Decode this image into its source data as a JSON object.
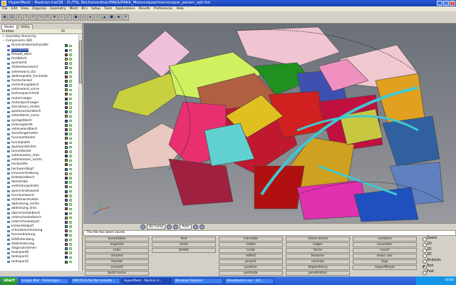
{
  "window": {
    "title": "HyperMesh - Nastran.hwl1B - D:/TSL Rechenordner/PAKA/PAKA_Monocoque/monocoque_param_opt.hm"
  },
  "menu": [
    "File",
    "Edit",
    "View",
    "Organize",
    "Geometry",
    "Mesh",
    "BCs",
    "Setup",
    "Tools",
    "Applications",
    "Results",
    "Preferences",
    "Help"
  ],
  "toolbar_icons": [
    "open-icon",
    "save-icon",
    "import-icon",
    "export-icon",
    "undo-icon",
    "redo-icon",
    "rotate-icon",
    "pan-icon",
    "zoom-icon",
    "fit-icon",
    "shade-icon",
    "wire-icon",
    "view-icon",
    "iso-icon",
    "top-icon",
    "front-icon",
    "side-icon",
    "light-icon"
  ],
  "panel": {
    "tabs": [
      "Model",
      "Utility"
    ],
    "header": {
      "entities": "Entities",
      "id": "ID"
    },
    "tree_top": [
      {
        "label": "Assembly Hierarchy"
      },
      {
        "label": "Components (80)"
      }
    ],
    "components": [
      {
        "name": "torsionsheberoehrplatte",
        "color": "#38a838"
      },
      {
        "name": "sitzrahmen",
        "color": "#2040d0"
      },
      {
        "name": "firewall_oben",
        "color": "#c03020"
      },
      {
        "name": "frontblech",
        "color": "#d8c020"
      },
      {
        "name": "querwand",
        "color": "#e070c0"
      },
      {
        "name": "sitzbankauswand",
        "color": "#a8a8a8"
      },
      {
        "name": "seitenwand_sitz",
        "color": "#30b0b0"
      },
      {
        "name": "abdeckplatte_frontseite",
        "color": "#e02020"
      },
      {
        "name": "frontschenkel",
        "color": "#808030"
      },
      {
        "name": "verbindungsblech",
        "color": "#3060a0"
      },
      {
        "name": "seitenwand_vorne",
        "color": "#90d030"
      },
      {
        "name": "kastenquerschnitt",
        "color": "#d06020"
      },
      {
        "name": "motortraeger",
        "color": "#7030a0"
      },
      {
        "name": "motorquertraeger",
        "color": "#40a060"
      },
      {
        "name": "sitzrahmen_hinten",
        "color": "#b02060"
      },
      {
        "name": "querbrueckenblech",
        "color": "#20a0d0"
      },
      {
        "name": "seitenblech_vorne",
        "color": "#e0a030"
      },
      {
        "name": "spriegelblech",
        "color": "#6040c0"
      },
      {
        "name": "lenkungsbrett",
        "color": "#50b050"
      },
      {
        "name": "seitenwandblech",
        "color": "#d03050"
      },
      {
        "name": "stossfangerhalter",
        "color": "#3080c0"
      },
      {
        "name": "fussraumboden",
        "color": "#a0a020"
      },
      {
        "name": "tunnelplatte",
        "color": "#c040a0"
      },
      {
        "name": "querwandhinten",
        "color": "#40c0a0"
      },
      {
        "name": "tunneldeckel",
        "color": "#e06040"
      },
      {
        "name": "seitenkasten_links",
        "color": "#2050b0"
      },
      {
        "name": "seitenkasten_rechts",
        "color": "#80b040"
      },
      {
        "name": "heckplatte",
        "color": "#b03030"
      },
      {
        "name": "heckwandkopf",
        "color": "#3070d0"
      },
      {
        "name": "kreuzverstrebung",
        "color": "#d0b040"
      },
      {
        "name": "federbeinblech",
        "color": "#5030a0"
      },
      {
        "name": "domstrebe",
        "color": "#30a070"
      },
      {
        "name": "verbindungsleiste",
        "color": "#c05080"
      },
      {
        "name": "querschnittswand",
        "color": "#2090c0"
      },
      {
        "name": "fussraumwand",
        "color": "#a06030"
      },
      {
        "name": "sitzlehnenstuetze",
        "color": "#6050d0"
      },
      {
        "name": "abdeckung_rechts",
        "color": "#40b040"
      },
      {
        "name": "abdeckung_links",
        "color": "#d04040"
      },
      {
        "name": "oberschenkelblech",
        "color": "#3050c0"
      },
      {
        "name": "unterschenkelblech",
        "color": "#b0a030"
      },
      {
        "name": "unterschenkelpart",
        "color": "#9040b0"
      },
      {
        "name": "kniewinkelpart",
        "color": "#30b090"
      },
      {
        "name": "schenkelverbindung",
        "color": "#e04060"
      },
      {
        "name": "fussverbindung",
        "color": "#2060b0"
      },
      {
        "name": "SUVAnbindung",
        "color": "#80c050"
      },
      {
        "name": "stabilisatorung",
        "color": "#c03080"
      },
      {
        "name": "diagonalrahmen",
        "color": "#3090d0"
      },
      {
        "name": "tankspant0",
        "color": "#a08030"
      },
      {
        "name": "tankspant1",
        "color": "#5040c0"
      },
      {
        "name": "tankspant2",
        "color": "#40a050"
      }
    ]
  },
  "viewport_strip": {
    "select": "By Comp",
    "auto": "Auto"
  },
  "status": {
    "message": "The file has been saved."
  },
  "panels": {
    "col1": [
      "assemblies",
      "organize",
      "color",
      "rename",
      "reorder",
      "convert",
      "build menu"
    ],
    "col2": [
      "find",
      "mask",
      "delete"
    ],
    "col3": [
      "translate",
      "rotate",
      "scale",
      "reflect",
      "project",
      "position",
      "permute"
    ],
    "col4": [
      "check elems",
      "edges",
      "faces",
      "features",
      "normals",
      "dependency",
      "penetration"
    ],
    "col5": [
      "numbers",
      "renumber",
      "count",
      "mass calc",
      "tags",
      "HyperMorph"
    ]
  },
  "radios": [
    {
      "label": "Geom",
      "on": false
    },
    {
      "label": "1D",
      "on": false
    },
    {
      "label": "2D",
      "on": false
    },
    {
      "label": "3D",
      "on": false
    },
    {
      "label": "Analysis",
      "on": false
    },
    {
      "label": "Tool",
      "on": true
    },
    {
      "label": "Post",
      "on": false
    }
  ],
  "taskbar": {
    "start": "start",
    "tasks": [
      "Google Mail - Posteingan...",
      "UNFOOLS By Macromedia...",
      "HyperMesh - Nastran.h...",
      "Windows Explorer",
      "Ghostbusters.avi - VLC..."
    ],
    "clock": "18:06"
  }
}
